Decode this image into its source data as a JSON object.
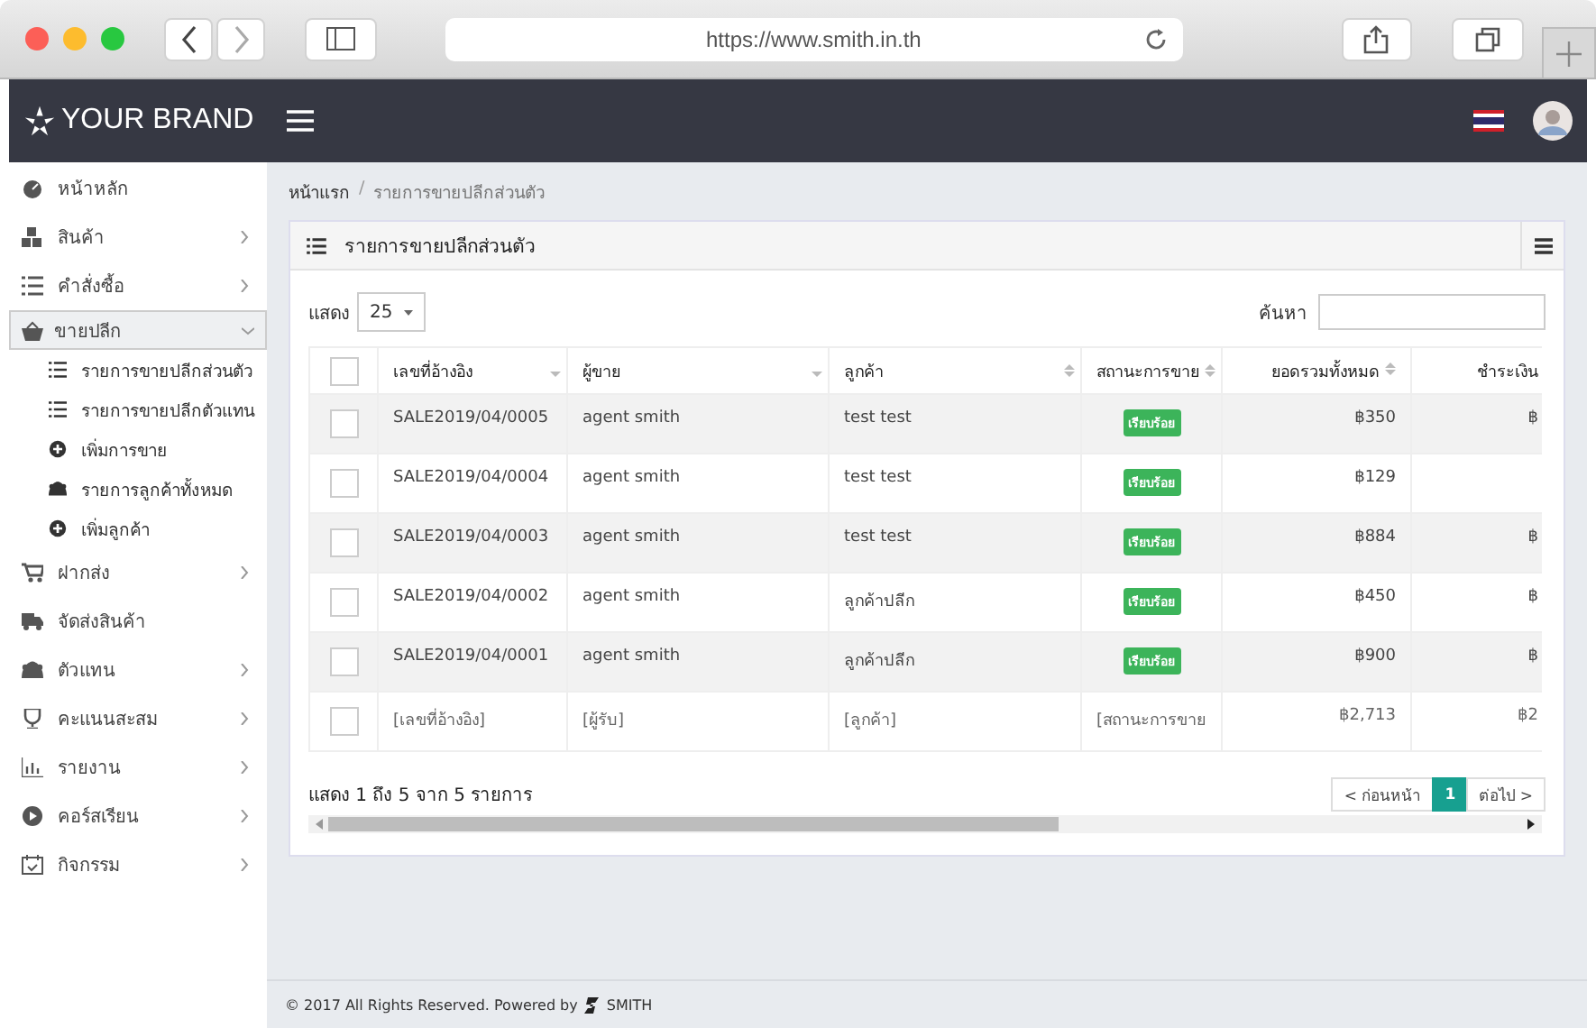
{
  "browser": {
    "url": "https://www.smith.in.th"
  },
  "header": {
    "brand": "YOUR BRAND"
  },
  "sidebar": {
    "items": [
      {
        "label": "หน้าหลัก",
        "kind": "link",
        "selected": false
      },
      {
        "label": "สินค้า",
        "kind": "menu",
        "expanded": false,
        "selected": false
      },
      {
        "label": "คำสั่งซื้อ",
        "kind": "menu",
        "expanded": false,
        "selected": false
      },
      {
        "label": "ขายปลีก",
        "kind": "menu",
        "expanded": true,
        "selected": true,
        "children": [
          {
            "label": "รายการขายปลีกส่วนตัว"
          },
          {
            "label": "รายการขายปลีกตัวแทน"
          },
          {
            "label": "เพิ่มการขาย"
          },
          {
            "label": "รายการลูกค้าทั้งหมด"
          },
          {
            "label": "เพิ่มลูกค้า"
          }
        ]
      },
      {
        "label": "ฝากส่ง",
        "kind": "menu",
        "expanded": false,
        "selected": false
      },
      {
        "label": "จัดส่งสินค้า",
        "kind": "link",
        "selected": false
      },
      {
        "label": "ตัวแทน",
        "kind": "menu",
        "expanded": false,
        "selected": false
      },
      {
        "label": "คะแนนสะสม",
        "kind": "menu",
        "expanded": false,
        "selected": false
      },
      {
        "label": "รายงาน",
        "kind": "menu",
        "expanded": false,
        "selected": false
      },
      {
        "label": "คอร์สเรียน",
        "kind": "menu",
        "expanded": false,
        "selected": false
      },
      {
        "label": "กิจกรรม",
        "kind": "menu",
        "expanded": false,
        "selected": false
      }
    ]
  },
  "breadcrumb": {
    "items": [
      "หน้าแรก",
      "รายการขายปลีกส่วนตัว"
    ],
    "separator": "/"
  },
  "card": {
    "title": "รายการขายปลีกส่วนตัว",
    "show_label": "แสดง",
    "page_size": "25",
    "search_label": "ค้นหา",
    "table": {
      "select_all_checked": false,
      "columns": [
        "เลขที่อ้างอิง",
        "ผู้ขาย",
        "ลูกค้า",
        "สถานะการขาย",
        "ยอดรวมทั้งหมด",
        "ชำระเงิน"
      ],
      "rows": [
        {
          "checked": false,
          "ref": "SALE2019/04/0005",
          "seller": "agent smith",
          "customer": "test test",
          "status": "เรียบร้อย",
          "total": "฿350",
          "payment": "฿"
        },
        {
          "checked": false,
          "ref": "SALE2019/04/0004",
          "seller": "agent smith",
          "customer": "test test",
          "status": "เรียบร้อย",
          "total": "฿129"
        },
        {
          "checked": false,
          "ref": "SALE2019/04/0003",
          "seller": "agent smith",
          "customer": "test test",
          "status": "เรียบร้อย",
          "total": "฿884",
          "payment": "฿"
        },
        {
          "checked": false,
          "ref": "SALE2019/04/0002",
          "seller": "agent smith",
          "customer": "ลูกค้าปลีก",
          "status": "เรียบร้อย",
          "total": "฿450",
          "payment": "฿"
        },
        {
          "checked": false,
          "ref": "SALE2019/04/0001",
          "seller": "agent smith",
          "customer": "ลูกค้าปลีก",
          "status": "เรียบร้อย",
          "total": "฿900",
          "payment": "฿"
        }
      ],
      "filter_row": {
        "checked": false,
        "ref": "[เลขที่อ้างอิง]",
        "seller": "[ผู้รับ]",
        "customer": "[ลูกค้า]",
        "status": "[สถานะการขาย",
        "total": "฿2,713",
        "payment": "฿2"
      }
    },
    "info": "แสดง 1 ถึง 5 จาก 5 รายการ",
    "pagination": [
      {
        "label": "< ก่อนหน้า",
        "selected": false
      },
      {
        "label": "1",
        "selected": true
      },
      {
        "label": "ต่อไป >",
        "selected": false
      }
    ]
  },
  "footer": {
    "text": "© 2017 All Rights Reserved. Powered by",
    "logo": "SMITH"
  }
}
